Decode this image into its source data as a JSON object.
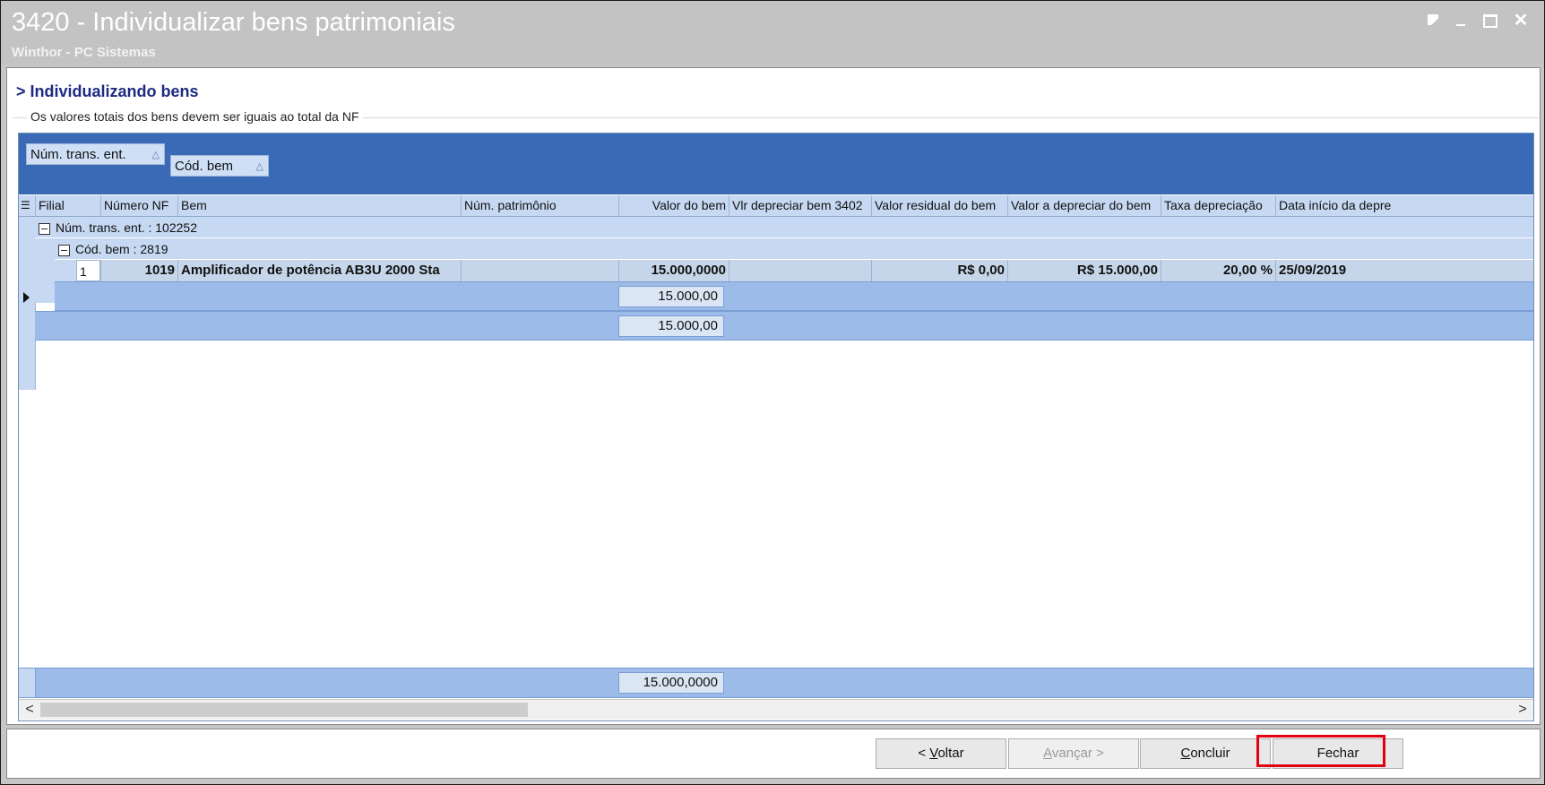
{
  "window": {
    "title": "3420 - Individualizar bens patrimoniais",
    "subtitle": "Winthor - PC Sistemas",
    "close_glyph": "✕"
  },
  "section": {
    "heading": "> Individualizando bens",
    "legend": "Os valores totais dos bens devem ser iguais ao total da NF"
  },
  "grid": {
    "group_by": [
      {
        "label": "Núm. trans. ent.",
        "sort_glyph": "△"
      },
      {
        "label": "Cód. bem",
        "sort_glyph": "△"
      }
    ],
    "columns": [
      "Filial",
      "Número NF",
      "Bem",
      "Núm. patrimônio",
      "Valor do bem",
      "Vlr depreciar bem 3402",
      "Valor residual do bem",
      "Valor a depreciar do bem",
      "Taxa depreciação",
      "Data início da depre"
    ],
    "group1_label": "Núm. trans. ent. : 102252",
    "group2_label": "Cód. bem : 2819",
    "row": {
      "filial": "1",
      "numero_nf": "1019",
      "bem": "Amplificador de potência AB3U 2000 Sta",
      "num_patrimonio": "",
      "valor_bem": "15.000,0000",
      "vlr_depreciar": "",
      "valor_residual": "R$ 0,00",
      "valor_a_depreciar": "R$ 15.000,00",
      "taxa": "20,00 %",
      "data_inicio": "25/09/2019"
    },
    "group2_total": "15.000,00",
    "group1_total": "15.000,00",
    "grand_total": "15.000,0000",
    "scroll_left": "<",
    "scroll_right": ">"
  },
  "buttons": {
    "back": {
      "prefix": "< ",
      "accel": "V",
      "rest": "oltar"
    },
    "next": {
      "accel": "A",
      "rest": "vançar >"
    },
    "finish": {
      "accel": "C",
      "rest": "oncluir"
    },
    "close": "Fechar"
  },
  "colors": {
    "group_panel": "#3a6ab5",
    "footer": "#9dbbe8",
    "highlight": "#e3000f"
  }
}
